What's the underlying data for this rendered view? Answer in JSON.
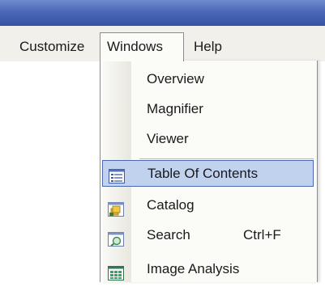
{
  "menubar": {
    "items": [
      {
        "label": "Customize"
      },
      {
        "label": "Windows"
      },
      {
        "label": "Help"
      }
    ]
  },
  "windows_menu": {
    "items": [
      {
        "label": "Overview"
      },
      {
        "label": "Magnifier"
      },
      {
        "label": "Viewer"
      },
      {
        "label": "Table Of Contents",
        "icon": "table-of-contents-icon",
        "highlighted": true
      },
      {
        "label": "Catalog",
        "icon": "catalog-icon"
      },
      {
        "label": "Search",
        "icon": "search-window-icon",
        "shortcut": "Ctrl+F"
      },
      {
        "label": "Image Analysis",
        "icon": "image-analysis-icon"
      }
    ]
  },
  "colors": {
    "titlebar": "#4a68b6",
    "highlight_fill": "#c1d2ee",
    "highlight_border": "#4b68b0"
  }
}
